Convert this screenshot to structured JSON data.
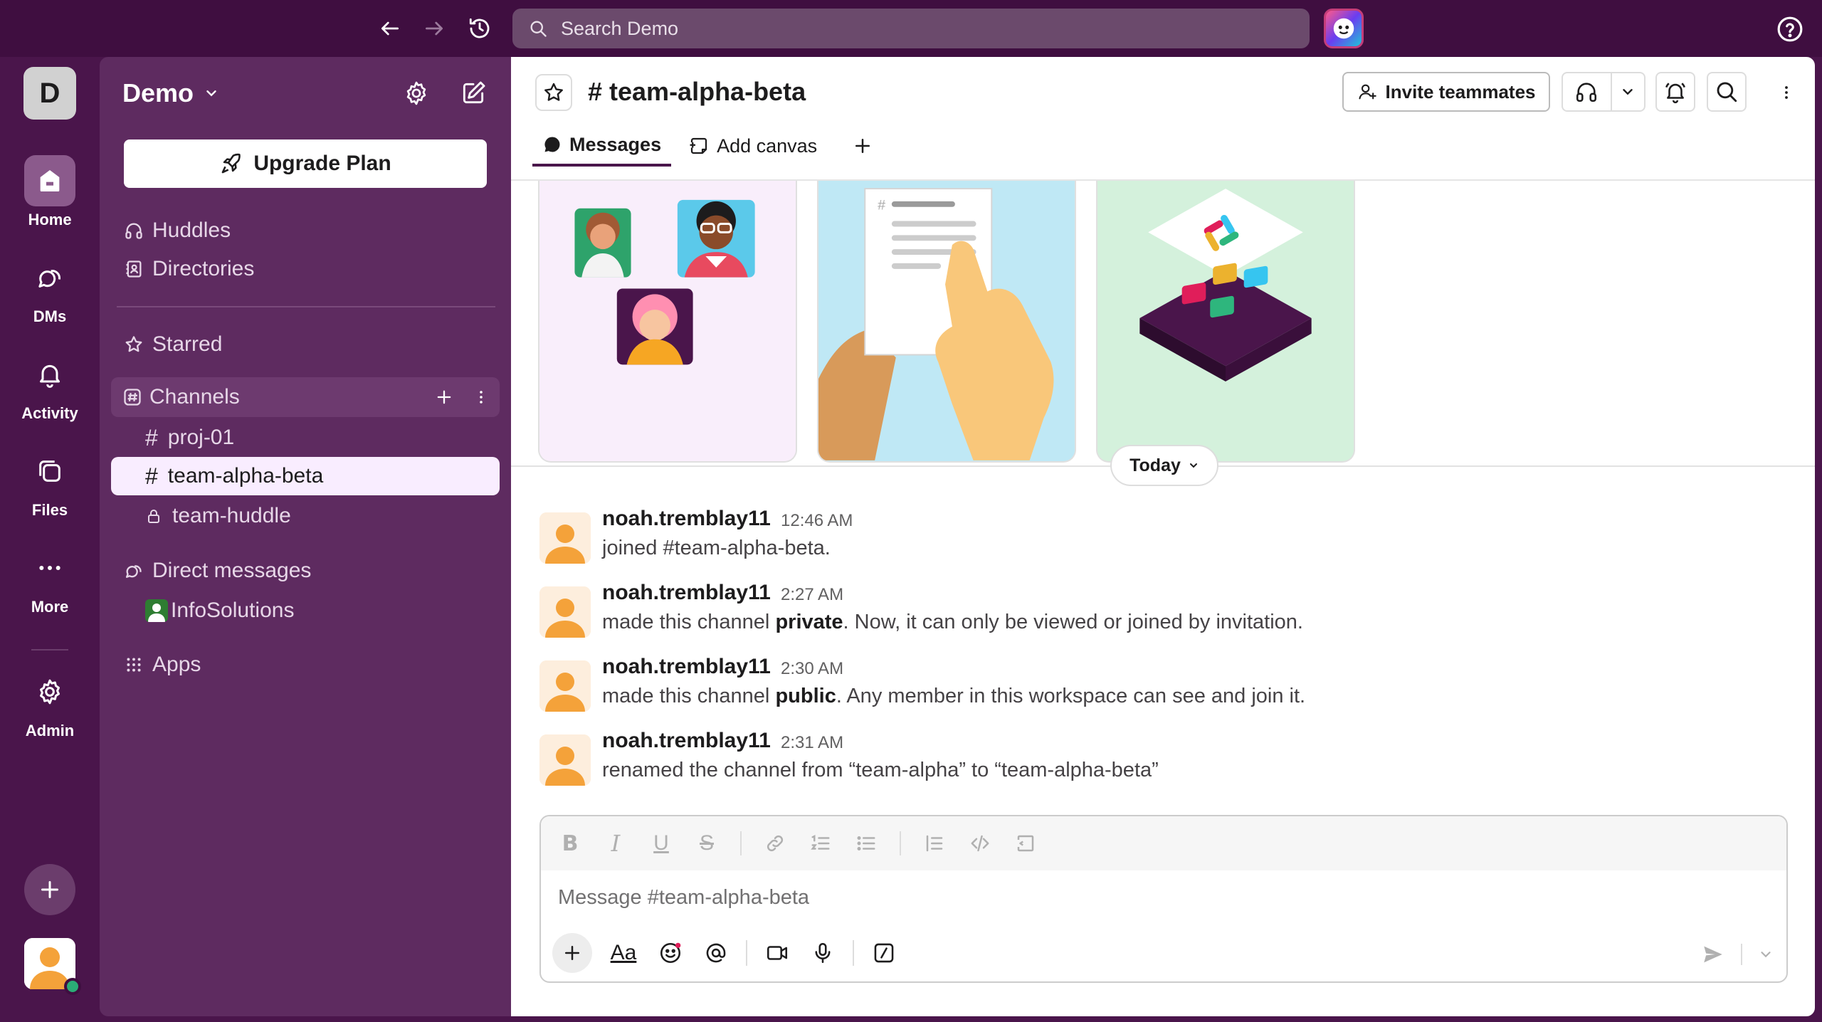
{
  "topbar": {
    "search_placeholder": "Search Demo"
  },
  "rail": {
    "workspace_initial": "D",
    "items": [
      {
        "label": "Home",
        "icon": "home-icon"
      },
      {
        "label": "DMs",
        "icon": "dms-icon"
      },
      {
        "label": "Activity",
        "icon": "bell-icon"
      },
      {
        "label": "Files",
        "icon": "files-icon"
      },
      {
        "label": "More",
        "icon": "more-icon"
      },
      {
        "label": "Admin",
        "icon": "gear-icon"
      }
    ]
  },
  "sidebar": {
    "workspace_name": "Demo",
    "upgrade_label": "Upgrade Plan",
    "huddles": "Huddles",
    "directories": "Directories",
    "starred": "Starred",
    "channels_header": "Channels",
    "channels": [
      "proj-01",
      "team-alpha-beta",
      "team-huddle"
    ],
    "direct_messages": "Direct messages",
    "dm_user": "InfoSolutions",
    "apps": "Apps"
  },
  "channel": {
    "name": "# team-alpha-beta",
    "invite_label": "Invite teammates",
    "tabs": {
      "messages": "Messages",
      "add_canvas": "Add canvas"
    },
    "date_label": "Today"
  },
  "messages": [
    {
      "user": "noah.tremblay11",
      "time": "12:46 AM",
      "text_plain": "joined #team-alpha-beta."
    },
    {
      "user": "noah.tremblay11",
      "time": "2:27 AM",
      "pre": "made this channel ",
      "bold": "private",
      "post": ". Now, it can only be viewed or joined by invitation."
    },
    {
      "user": "noah.tremblay11",
      "time": "2:30 AM",
      "pre": "made this channel ",
      "bold": "public",
      "post": ". Any member in this workspace can see and join it."
    },
    {
      "user": "noah.tremblay11",
      "time": "2:31 AM",
      "text_plain": "renamed the channel from “team-alpha” to “team-alpha-beta”"
    }
  ],
  "composer": {
    "placeholder": "Message #team-alpha-beta",
    "format_label": "Aa"
  },
  "colors": {
    "aubergine_dark": "#3f0e40",
    "sidebar": "#5e2b60",
    "selected_channel_bg": "#f9edff",
    "avatar_orange": "#f4a23a"
  }
}
